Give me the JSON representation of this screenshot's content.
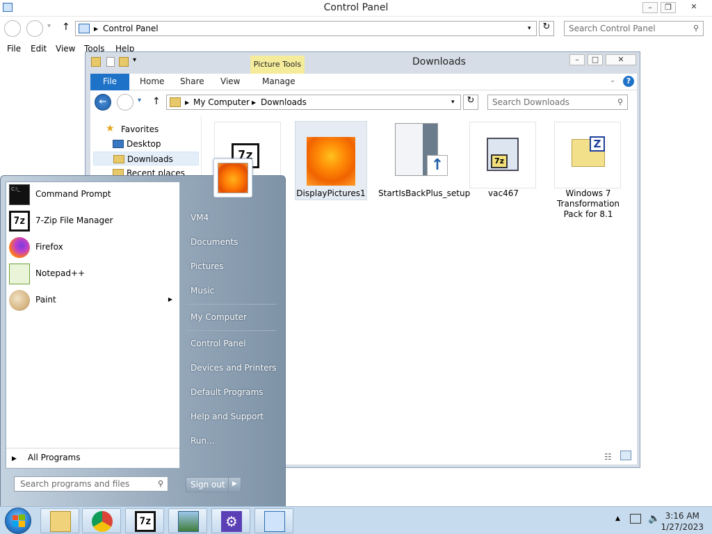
{
  "control_panel": {
    "title": "Control Panel",
    "address": "Control Panel",
    "search_placeholder": "Search Control Panel",
    "menu": [
      "File",
      "Edit",
      "View",
      "Tools",
      "Help"
    ]
  },
  "downloads": {
    "title": "Downloads",
    "contextual_tab": "Picture Tools",
    "ribbon_tabs": [
      "File",
      "Home",
      "Share",
      "View",
      "Manage"
    ],
    "breadcrumb": [
      "My Computer",
      "Downloads"
    ],
    "search_placeholder": "Search Downloads",
    "nav": [
      "Favorites",
      "Desktop",
      "Downloads",
      "Recent places"
    ],
    "files": [
      {
        "name": "",
        "icon": "7zip-icon"
      },
      {
        "name": "DisplayPictures1",
        "icon": "flower-picture-icon"
      },
      {
        "name": "StartIsBackPlus_setup",
        "icon": "installer-icon"
      },
      {
        "name": "vac467",
        "icon": "7zip-installer-icon"
      },
      {
        "name": "Windows 7 Transformation Pack for 8.1",
        "icon": "zip-folder-icon"
      }
    ]
  },
  "start_menu": {
    "programs": [
      "Command Prompt",
      "7-Zip File Manager",
      "Firefox",
      "Notepad++",
      "Paint"
    ],
    "all_programs": "All Programs",
    "search_placeholder": "Search programs and files",
    "right_items": [
      "VM4",
      "Documents",
      "Pictures",
      "Music",
      "My Computer",
      "Control Panel",
      "Devices and Printers",
      "Default Programs",
      "Help and Support",
      "Run..."
    ],
    "sign_out": "Sign out"
  },
  "taskbar": {
    "apps": [
      "file-explorer-icon",
      "chrome-icon",
      "7zip-icon",
      "picture-viewer-icon",
      "settings-icon",
      "control-panel-icon"
    ],
    "time": "3:16 AM",
    "date": "1/27/2023"
  }
}
